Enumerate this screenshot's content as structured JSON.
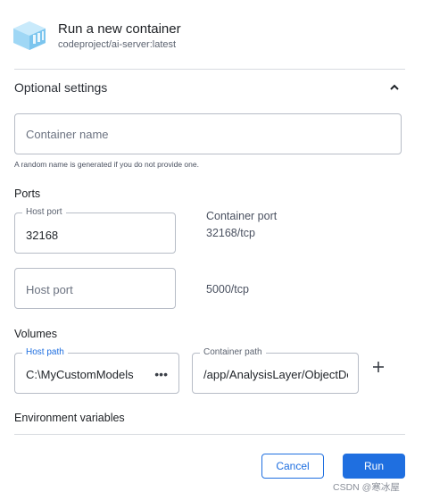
{
  "header": {
    "title": "Run a new container",
    "image": "codeproject/ai-server:latest",
    "logo_icon": "docker-box-icon"
  },
  "optional_settings": {
    "title": "Optional settings",
    "expanded": true,
    "container_name": {
      "placeholder": "Container name",
      "value": "",
      "helper": "A random name is generated if you do not provide one."
    }
  },
  "ports": {
    "title": "Ports",
    "rows": [
      {
        "host_label": "Host port",
        "host_value": "32168",
        "container_label": "Container port",
        "container_value": "32168/tcp"
      },
      {
        "host_placeholder": "Host port",
        "host_value": "",
        "container_value": "5000/tcp"
      }
    ]
  },
  "volumes": {
    "title": "Volumes",
    "host_path_label": "Host path",
    "host_path_value": "C:\\MyCustomModels",
    "browse_label": "•••",
    "container_path_label": "Container path",
    "container_path_value": "/app/AnalysisLayer/ObjectDe"
  },
  "environment": {
    "title": "Environment variables"
  },
  "actions": {
    "cancel": "Cancel",
    "run": "Run"
  },
  "watermark": "CSDN @寒冰屋",
  "colors": {
    "accent": "#1f6fe0",
    "logo": "#8fd0f3",
    "border": "#b7bcc6"
  }
}
